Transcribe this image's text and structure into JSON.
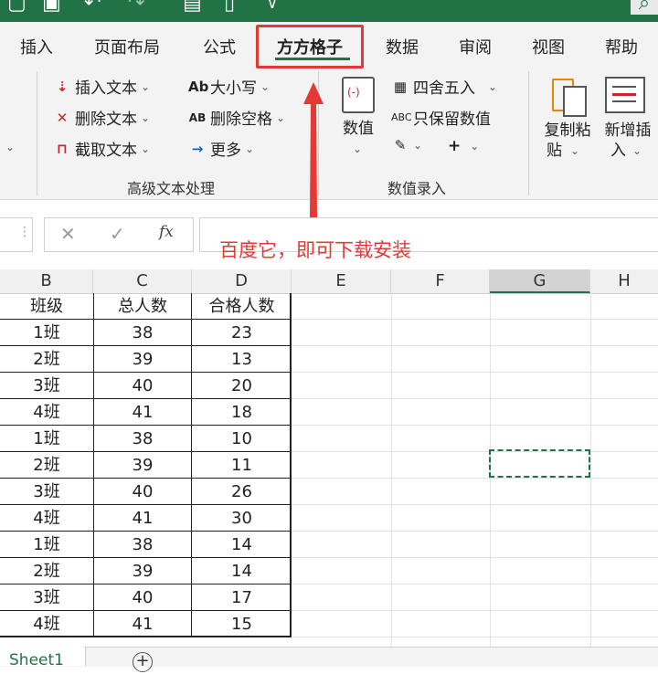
{
  "tabs": [
    {
      "label": "插入"
    },
    {
      "label": "页面布局"
    },
    {
      "label": "公式"
    },
    {
      "label": "方方格子"
    },
    {
      "label": "数据"
    },
    {
      "label": "审阅"
    },
    {
      "label": "视图"
    },
    {
      "label": "帮助"
    }
  ],
  "ribbon": {
    "text_group": {
      "label": "高级文本处理",
      "buttons": [
        {
          "label": "插入文本",
          "icon": "insert-text-icon"
        },
        {
          "label": "删除文本",
          "icon": "delete-text-icon"
        },
        {
          "label": "截取文本",
          "icon": "extract-text-icon"
        },
        {
          "label": "大小写",
          "icon_text": "Ab"
        },
        {
          "label": "删除空格",
          "icon_text": "AB"
        },
        {
          "label": "更多",
          "icon_text": "→"
        }
      ]
    },
    "number_group": {
      "label": "数值录入",
      "numeric_label": "数值",
      "buttons": [
        {
          "label": "四舍五入"
        },
        {
          "label": "只保留数值",
          "icon_text": "ABC"
        }
      ],
      "plus_label": "+"
    },
    "copy_paste": {
      "line1": "复制粘",
      "line2": "贴"
    },
    "new_insert": {
      "line1": "新增插",
      "line2": "入"
    }
  },
  "formula_bar": {
    "cancel": "✕",
    "confirm": "✓",
    "fx": "fx"
  },
  "annotation": "百度它，即可下载安装",
  "columns": [
    "B",
    "C",
    "D",
    "E",
    "F",
    "G",
    "H"
  ],
  "selected_column": "G",
  "table": {
    "headers": [
      "班级",
      "总人数",
      "合格人数"
    ],
    "rows": [
      [
        "1班",
        "38",
        "23"
      ],
      [
        "2班",
        "39",
        "13"
      ],
      [
        "3班",
        "40",
        "20"
      ],
      [
        "4班",
        "41",
        "18"
      ],
      [
        "1班",
        "38",
        "10"
      ],
      [
        "2班",
        "39",
        "11"
      ],
      [
        "3班",
        "40",
        "26"
      ],
      [
        "4班",
        "41",
        "30"
      ],
      [
        "1班",
        "38",
        "14"
      ],
      [
        "2班",
        "39",
        "14"
      ],
      [
        "3班",
        "40",
        "17"
      ],
      [
        "4班",
        "41",
        "15"
      ]
    ]
  },
  "sheets": [
    {
      "label": "Sheet1"
    }
  ],
  "add_sheet_label": "+",
  "colors": {
    "accent": "#217346",
    "annotation": "#e53935"
  }
}
